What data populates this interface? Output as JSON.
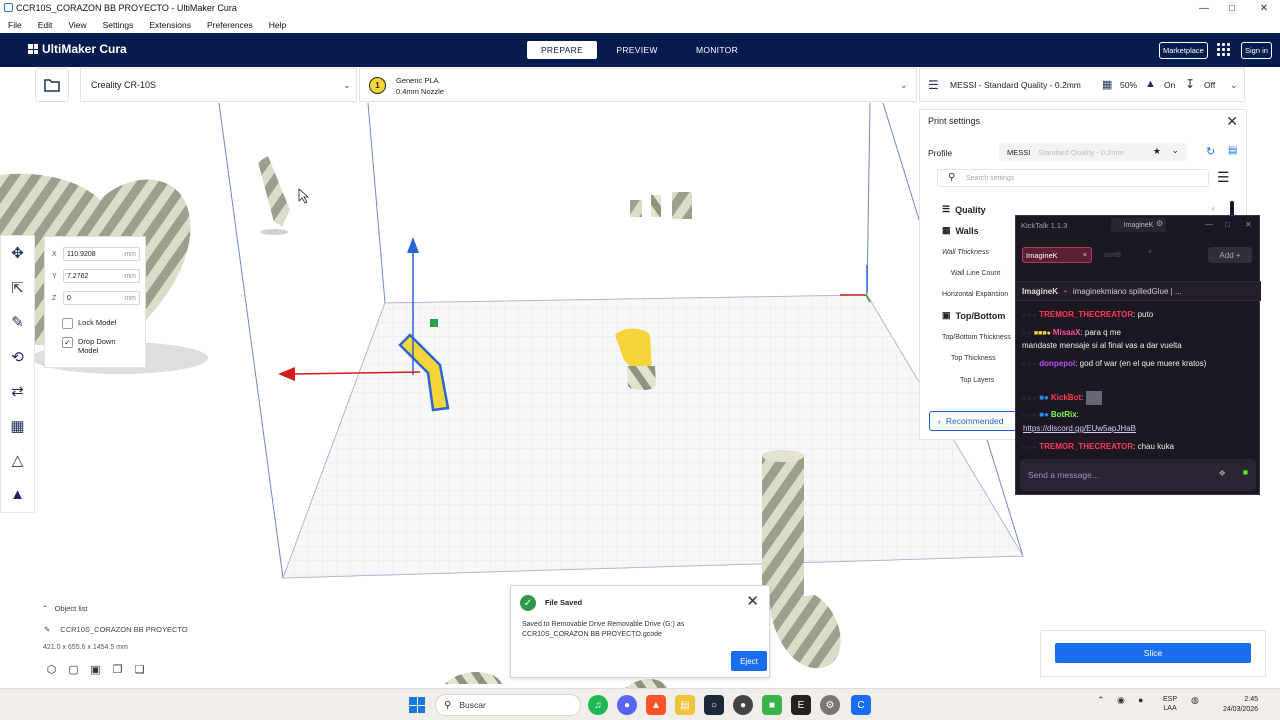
{
  "window": {
    "title": "CCR10S_CORAZON BB PROYECTO - UltiMaker Cura"
  },
  "menu": [
    "File",
    "Edit",
    "View",
    "Settings",
    "Extensions",
    "Preferences",
    "Help"
  ],
  "header": {
    "brand": "UltiMaker Cura",
    "stages": [
      "PREPARE",
      "PREVIEW",
      "MONITOR"
    ],
    "active_stage": "PREPARE",
    "marketplace": "Marketplace",
    "signin": "Sign in"
  },
  "printer": {
    "name": "Creality CR-10S"
  },
  "material": {
    "badge": "1",
    "name": "Generic PLA",
    "nozzle": "0.4mm Nozzle"
  },
  "quality_bar": {
    "profile": "MESSI - Standard Quality - 0.2mm",
    "infill": "50%",
    "support": "On",
    "adhesion": "Off"
  },
  "move_tool": {
    "x_label": "X",
    "x_value": "110.9208",
    "y_label": "Y",
    "y_value": "7.2762",
    "z_label": "Z",
    "z_value": "0",
    "unit": "mm",
    "lock_model": "Lock Model",
    "drop_down": "Drop Down Model"
  },
  "print_settings": {
    "title": "Print settings",
    "profile_label": "Profile",
    "profile_name": "MESSI",
    "profile_detail": "Standard Quality - 0.2mm",
    "search_placeholder": "Search settings",
    "cat_quality": "Quality",
    "cat_walls": "Walls",
    "wall_thickness": "Wall Thickness",
    "wall_line_count": "Wall Line Count",
    "horizontal_expansion": "Horizontal Expansion",
    "cat_topbottom": "Top/Bottom",
    "topbottom_thickness": "Top/Bottom Thickness",
    "top_thickness": "Top Thickness",
    "top_layers": "Top Layers",
    "recommended": "Recommended"
  },
  "kicktalk": {
    "title": "KickTalk 1.1.3",
    "tab_user": "ImagineK",
    "chip": "ImagineK",
    "chip2": "soni9",
    "add": "Add",
    "channel_name": "ImagineK",
    "channel_topic": "imaginekmiano spilledGlue | ...",
    "messages": [
      {
        "user": "TREMOR_THECREATOR",
        "color": "#ff3b5c",
        "text": "puto"
      },
      {
        "user": "MisaaX",
        "color": "#ff4fa0",
        "text": "para q me"
      },
      {
        "user": "",
        "color": "#eeeeee",
        "text": "mandaste mensaje si al final vas a dar vuelta"
      },
      {
        "user": "donpepoi",
        "color": "#b84dff",
        "text": "god of war (en el que muere kratos)"
      },
      {
        "user": "KickBot",
        "color": "#ff3b5c",
        "text": ""
      },
      {
        "user": "BotRix",
        "color": "#7cff4f",
        "text": ""
      },
      {
        "user": "TREMOR_THECREATOR",
        "color": "#ff3b5c",
        "text": "chau kuka"
      }
    ],
    "link": "https://discord.gg/EUw5apJHaB",
    "input_placeholder": "Send a message..."
  },
  "object_list": {
    "label": "Object list",
    "name": "CCR10S_CORAZON BB PROYECTO",
    "dims": "421.0 x 655.6 x 1454.5 mm"
  },
  "toast": {
    "title": "File Saved",
    "body": "Saved to Removable Drive Removable Drive (G:) as CCR10S_CORAZON BB PROYECTO.gcode",
    "eject": "Eject"
  },
  "slice": {
    "label": "Slice"
  },
  "taskbar": {
    "search": "Buscar",
    "lang1": "ESP",
    "lang2": "LAA",
    "time": "2:45",
    "date": "24/03/2026"
  },
  "colors": {
    "header_bg": "#061c4e",
    "accent_blue": "#196ef0",
    "model_yellow": "#f6d53a",
    "kick_bg": "#1c1822"
  }
}
